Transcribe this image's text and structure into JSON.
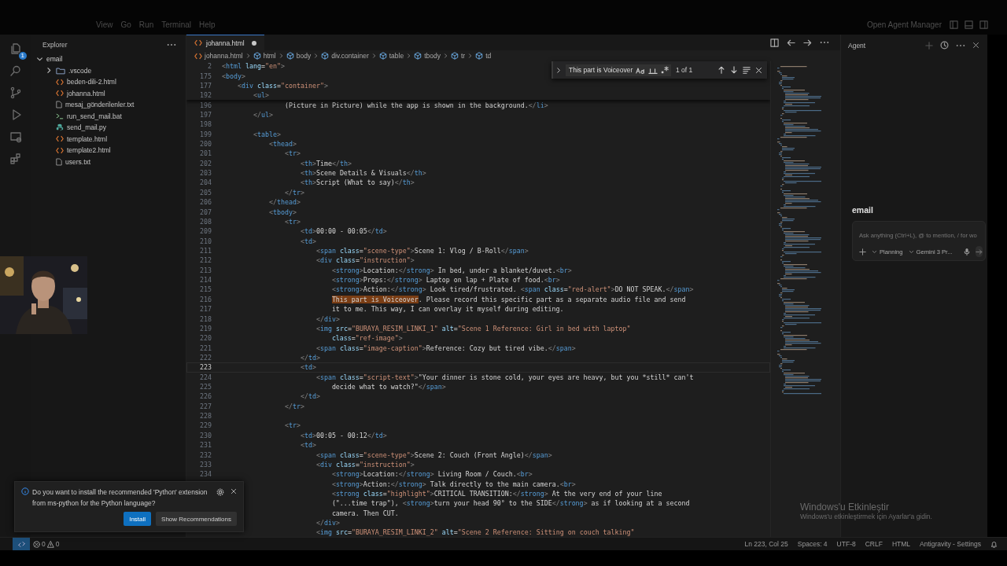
{
  "title_bar": {
    "menu": [
      "View",
      "Go",
      "Run",
      "Terminal",
      "Help"
    ],
    "agent_manager": "Open Agent Manager"
  },
  "activity_bar": {
    "badge": "1"
  },
  "explorer": {
    "title": "Explorer",
    "tree": [
      {
        "label": "email",
        "kind": "folder",
        "expanded": true,
        "children": [
          {
            "label": ".vscode",
            "kind": "folder",
            "expanded": false
          },
          {
            "label": "beden-dili-2.html",
            "kind": "html"
          },
          {
            "label": "johanna.html",
            "kind": "html"
          },
          {
            "label": "mesaj_gönderilenler.txt",
            "kind": "txt"
          },
          {
            "label": "run_send_mail.bat",
            "kind": "bat"
          },
          {
            "label": "send_mail.py",
            "kind": "py"
          },
          {
            "label": "template.html",
            "kind": "html"
          },
          {
            "label": "template2.html",
            "kind": "html"
          },
          {
            "label": "users.txt",
            "kind": "txt"
          }
        ]
      }
    ]
  },
  "editor": {
    "tab": {
      "label": "johanna.html",
      "modified": true,
      "selected": true
    },
    "breadcrumbs": [
      "johanna.html",
      "html",
      "body",
      "div.container",
      "table",
      "tbody",
      "tr",
      "td"
    ],
    "find": {
      "query": "This part is Voiceover",
      "result": "1 of 1"
    },
    "sticky_lines": [
      {
        "number": "2",
        "code": "<html lang=\"en\">"
      },
      {
        "number": "175",
        "code": "<body>"
      },
      {
        "number": "177",
        "code": "    <div class=\"container\">"
      },
      {
        "number": "192",
        "code": "        <ul>"
      }
    ],
    "lines": [
      {
        "number": "196",
        "current": false,
        "code": "                (Picture in Picture) while the app is shown in the background.</li>"
      },
      {
        "number": "197",
        "current": false,
        "code": "        </ul>"
      },
      {
        "number": "198",
        "current": false
      },
      {
        "number": "199",
        "current": false,
        "code": "        <table>"
      },
      {
        "number": "200",
        "current": false,
        "code": "            <thead>"
      },
      {
        "number": "201",
        "current": false,
        "code": "                <tr>"
      },
      {
        "number": "202",
        "current": false,
        "code": "                    <th>Time</th>"
      },
      {
        "number": "203",
        "current": false,
        "code": "                    <th>Scene Details & Visuals</th>"
      },
      {
        "number": "204",
        "current": false,
        "code": "                    <th>Script (What to say)</th>"
      },
      {
        "number": "205",
        "current": false,
        "code": "                </tr>"
      },
      {
        "number": "206",
        "current": false,
        "code": "            </thead>"
      },
      {
        "number": "207",
        "current": false,
        "code": "            <tbody>"
      },
      {
        "number": "208",
        "current": false,
        "code": "                <tr>"
      },
      {
        "number": "209",
        "current": false,
        "code": "                    <td>00:00 - 00:05</td>"
      },
      {
        "number": "210",
        "current": false,
        "code": "                    <td>"
      },
      {
        "number": "211",
        "current": false,
        "code": "                        <span class=\"scene-type\">Scene 1: Vlog / B-Roll</span>"
      },
      {
        "number": "212",
        "current": false,
        "code": "                        <div class=\"instruction\">"
      },
      {
        "number": "213",
        "current": false,
        "code": "                            <strong>Location:</strong> In bed, under a blanket/duvet.<br>"
      },
      {
        "number": "214",
        "current": false,
        "code": "                            <strong>Props:</strong> Laptop on lap + Plate of food.<br>"
      },
      {
        "number": "215",
        "current": false,
        "code": "                            <strong>Action:</strong> Look tired/frustrated. <span class=\"red-alert\">DO NOT SPEAK.</span>"
      },
      {
        "number": "216",
        "current": false,
        "parts": [
          {
            "text": "                            This part is Voiceover",
            "match": true
          },
          {
            "text": ". Please record this specific part as a separate audio file and send",
            "match": false
          }
        ]
      },
      {
        "number": "217",
        "current": false,
        "code": "                            it to me. This way, I can overlay it myself during editing."
      },
      {
        "number": "218",
        "current": false,
        "code": "                        </div>"
      },
      {
        "number": "219",
        "current": false,
        "code": "                        <img src=\"BURAYA_RESIM_LINKI_1\" alt=\"Scene 1 Reference: Girl in bed with laptop\""
      },
      {
        "number": "220",
        "current": false,
        "code": "                            class=\"ref-image\">"
      },
      {
        "number": "221",
        "current": false,
        "code": "                        <span class=\"image-caption\">Reference: Cozy but tired vibe.</span>"
      },
      {
        "number": "222",
        "current": false,
        "code": "                    </td>"
      },
      {
        "number": "223",
        "current": true,
        "code": "                    <td>"
      },
      {
        "number": "224",
        "current": false,
        "code": "                        <span class=\"script-text\">\"Your dinner is stone cold, your eyes are heavy, but you *still* can't"
      },
      {
        "number": "225",
        "current": false,
        "code": "                            decide what to watch?\"</span>"
      },
      {
        "number": "226",
        "current": false,
        "code": "                    </td>"
      },
      {
        "number": "227",
        "current": false,
        "code": "                </tr>"
      },
      {
        "number": "228",
        "current": false
      },
      {
        "number": "229",
        "current": false,
        "code": "                <tr>"
      },
      {
        "number": "230",
        "current": false,
        "code": "                    <td>00:05 - 00:12</td>"
      },
      {
        "number": "231",
        "current": false,
        "code": "                    <td>"
      },
      {
        "number": "232",
        "current": false,
        "code": "                        <span class=\"scene-type\">Scene 2: Couch (Front Angle)</span>"
      },
      {
        "number": "233",
        "current": false,
        "code": "                        <div class=\"instruction\">"
      },
      {
        "number": "234",
        "current": false,
        "code": "                            <strong>Location:</strong> Living Room / Couch.<br>"
      },
      {
        "current": false,
        "code": "                            <strong>Action:</strong> Talk directly to the main camera.<br>"
      },
      {
        "current": false,
        "code": "                            <strong class=\"highlight\">CRITICAL TRANSITION:</strong> At the very end of your line"
      },
      {
        "current": false,
        "code": "                            (\"...time trap\"), <strong>turn your head 90° to the SIDE</strong> as if looking at a second"
      },
      {
        "current": false,
        "code": "                            camera. Then CUT."
      },
      {
        "current": false,
        "code": "                        </div>"
      },
      {
        "current": false,
        "code": "                        <img src=\"BURAYA_RESIM_LINKI_2\" alt=\"Scene 2 Reference: Sitting on couch talking\""
      }
    ]
  },
  "agent": {
    "title": "Agent",
    "heading": "email",
    "placeholder": "Ask anything (Ctrl+L), @ to mention, / for wo",
    "mode": "Planning",
    "model": "Gemini 3 Pr..."
  },
  "notification": {
    "message": "Do you want to install the recommended 'Python' extension from ms-python for the Python language?",
    "buttons": [
      {
        "label": "Install",
        "kind": "primary"
      },
      {
        "label": "Show Recommendations",
        "kind": "secondary"
      }
    ]
  },
  "status_bar": {
    "errors": "0",
    "warnings": "0",
    "items": [
      "Ln 223, Col 25",
      "Spaces: 4",
      "UTF-8",
      "CRLF",
      "HTML",
      "Antigravity - Settings"
    ]
  },
  "activation": {
    "title": "Windows'u Etkinleştir",
    "subtitle": "Windows'u etkinleştirmek için Ayarlar'a gidin."
  }
}
